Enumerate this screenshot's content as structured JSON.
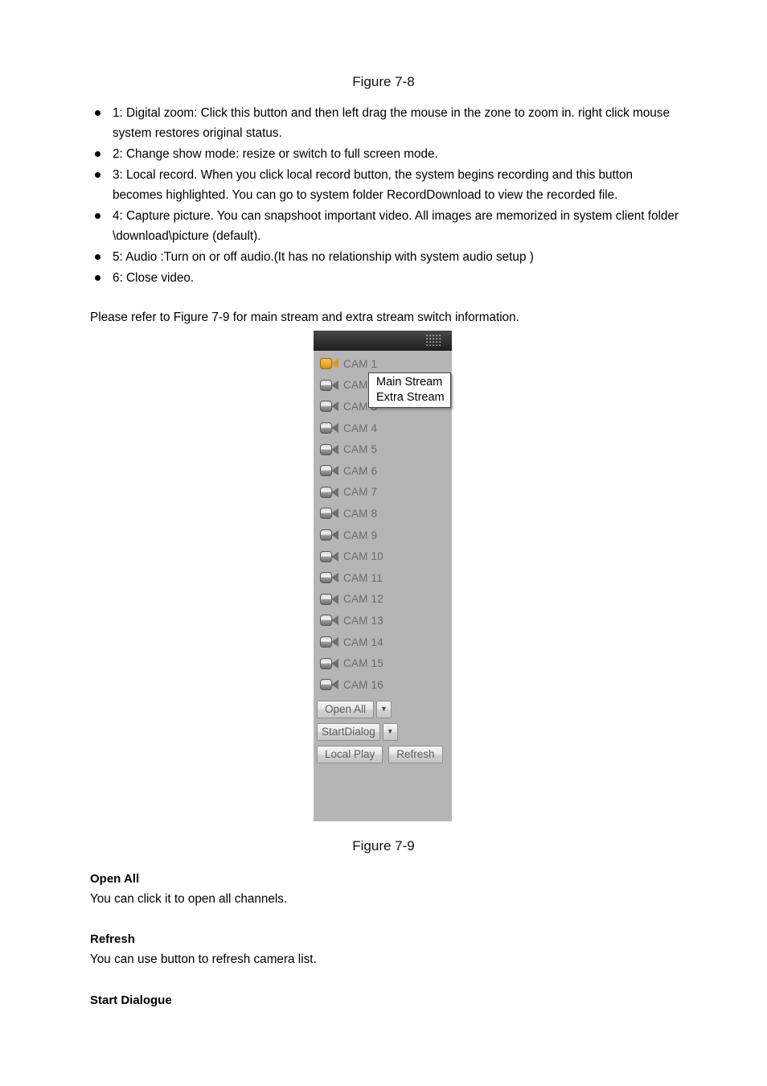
{
  "figure_7_8_caption": "Figure 7-8",
  "figure_7_9_caption": "Figure 7-9",
  "bullets": [
    {
      "text": "1: Digital zoom: Click this button and then left drag the mouse in the zone to zoom in. right click mouse system restores original status."
    },
    {
      "text": "2: Change show mode: resize or switch to full screen mode."
    },
    {
      "text": "3: Local record. When you click local record button, the system begins recording and this button becomes highlighted. You can go to system folder RecordDownload to view the recorded file."
    },
    {
      "text": "4: Capture picture. You can snapshoot important video. All images are memorized in system client folder \\download\\picture (default)."
    },
    {
      "text": "5: Audio :Turn on or off audio.(It has no relationship with system audio setup )"
    },
    {
      "text": "6: Close video."
    }
  ],
  "refer_line": "Please refer to Figure 7-9 for main stream and extra stream switch information.",
  "camera_panel": {
    "cameras": [
      {
        "label": "CAM 1",
        "state": "active"
      },
      {
        "label": "CAM 2",
        "state": "idle"
      },
      {
        "label": "CAM 3",
        "state": "idle"
      },
      {
        "label": "CAM 4",
        "state": "idle"
      },
      {
        "label": "CAM 5",
        "state": "idle"
      },
      {
        "label": "CAM 6",
        "state": "idle"
      },
      {
        "label": "CAM 7",
        "state": "idle"
      },
      {
        "label": "CAM 8",
        "state": "idle"
      },
      {
        "label": "CAM 9",
        "state": "idle"
      },
      {
        "label": "CAM 10",
        "state": "idle"
      },
      {
        "label": "CAM 11",
        "state": "idle"
      },
      {
        "label": "CAM 12",
        "state": "idle"
      },
      {
        "label": "CAM 13",
        "state": "idle"
      },
      {
        "label": "CAM 14",
        "state": "idle"
      },
      {
        "label": "CAM 15",
        "state": "idle"
      },
      {
        "label": "CAM 16",
        "state": "idle"
      }
    ],
    "stream_menu": {
      "main_stream": "Main Stream",
      "extra_stream": "Extra Stream"
    },
    "buttons": {
      "open_all": "Open All",
      "open_all_arrow": "▼",
      "start_dialog": "StartDialog",
      "start_dialog_arrow": "▼",
      "local_play": "Local Play",
      "refresh": "Refresh"
    },
    "colors": {
      "panel_background": "#b5b5b5",
      "header_dark": "#2a2a2a",
      "active_camera_icon": "#e8a020",
      "idle_camera_icon": "#8f8f8f",
      "label_text": "#6b6b6b"
    }
  },
  "sections": [
    {
      "heading": "Open All",
      "body": "You can click it to open all channels."
    },
    {
      "heading": "Refresh",
      "body": "You can use button to refresh camera list."
    },
    {
      "heading": "Start Dialogue",
      "body": ""
    }
  ]
}
